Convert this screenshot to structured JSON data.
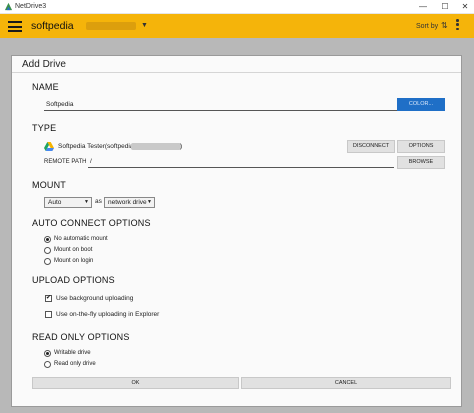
{
  "window": {
    "title": "NetDrive3",
    "min_icon": "minimize-icon",
    "max_icon": "maximize-icon",
    "close_icon": "close-icon",
    "min_glyph": "—",
    "max_glyph": "☐",
    "close_glyph": "✕"
  },
  "toolbar": {
    "drive_name": "softpedia",
    "caret": "▼",
    "sort_label": "Sort by",
    "sort_glyph": "⇅",
    "accent": "#f5b40a"
  },
  "dialog": {
    "title": "Add Drive",
    "name": {
      "header": "NAME",
      "value": "Softpedia",
      "color_button": "COLOR..."
    },
    "type": {
      "header": "TYPE",
      "account_text": "Softpedia Tester(softpedia",
      "account_suffix": ")",
      "disconnect_button": "DISCONNECT",
      "options_button": "OPTIONS",
      "remote_path_label": "REMOTE PATH",
      "remote_path_value": "/",
      "browse_button": "BROWSE"
    },
    "mount": {
      "header": "MOUNT",
      "drive_letter": "Auto",
      "as_label": "as",
      "mount_type": "network drive",
      "caret": "▼"
    },
    "auto_connect": {
      "header": "AUTO CONNECT OPTIONS",
      "options": [
        "No automatic mount",
        "Mount on boot",
        "Mount on login"
      ],
      "selected": 0
    },
    "upload": {
      "header": "UPLOAD OPTIONS",
      "options": [
        {
          "label": "Use background uploading",
          "checked": true
        },
        {
          "label": "Use on-the-fly uploading in Explorer",
          "checked": false
        }
      ],
      "check_glyph": "✔"
    },
    "read_only": {
      "header": "READ ONLY OPTIONS",
      "options": [
        "Writable drive",
        "Read only drive"
      ],
      "selected": 0
    },
    "ok_button": "OK",
    "cancel_button": "CANCEL"
  }
}
